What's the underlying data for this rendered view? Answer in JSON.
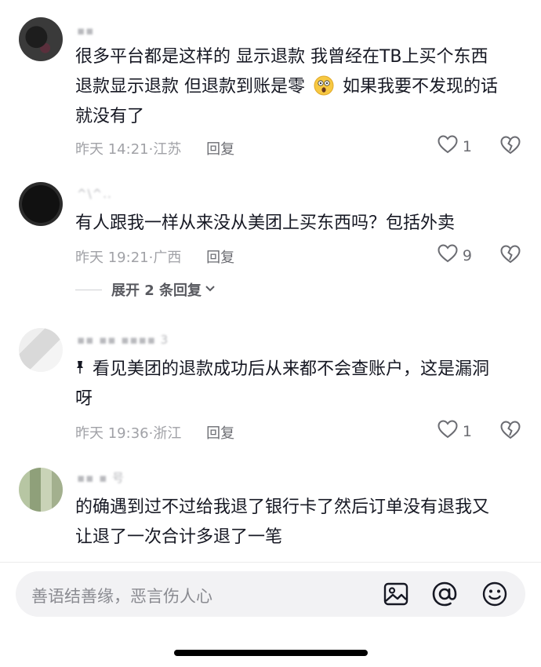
{
  "comments": [
    {
      "username": "▪▪",
      "text_line1": "很多平台都是这样的 显示退款 我曾经在TB上买个东西",
      "text_line2_a": "退款显示退款 但退款到账是零",
      "text_line2_b": "如果我要不发现的话",
      "text_line3": "就没有了",
      "time": "昨天 14:21",
      "location": "江苏",
      "reply_label": "回复",
      "likes": "1"
    },
    {
      "username": "^\\^..",
      "text_line1": "有人跟我一样从来没从美团上买东西吗？包括外卖",
      "time": "昨天 19:21",
      "location": "广西",
      "reply_label": "回复",
      "likes": "9",
      "expand_label": "展开 2 条回复"
    },
    {
      "username": "▪▪ ▪▪ ▪▪▪▪ 3",
      "text_line1": "看见美团的退款成功后从来都不会查账户，这是漏洞",
      "text_line2": "呀",
      "time": "昨天 19:36",
      "location": "浙江",
      "reply_label": "回复",
      "likes": "1"
    },
    {
      "username": "▪▪ ▪ 号",
      "text_line1": "的确遇到过不过给我退了银行卡了然后订单没有退我又",
      "text_line2": "让退了一次合计多退了一笔"
    }
  ],
  "input": {
    "placeholder": "善语结善缘，恶言伤人心"
  },
  "icons": {
    "image": "image-icon",
    "mention": "at-icon",
    "emoji": "emoji-icon",
    "like": "heart-icon",
    "dislike": "broken-heart-icon"
  }
}
